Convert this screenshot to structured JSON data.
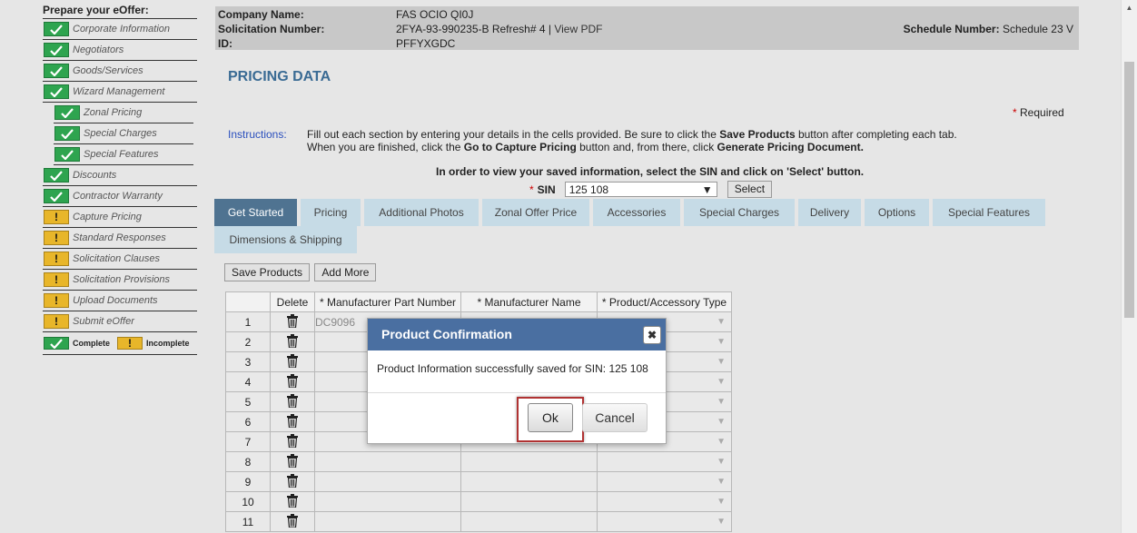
{
  "sidebar": {
    "title": "Prepare your eOffer:",
    "items": [
      {
        "label": "Corporate Information",
        "status": "complete"
      },
      {
        "label": "Negotiators",
        "status": "complete"
      },
      {
        "label": "Goods/Services",
        "status": "complete"
      },
      {
        "label": "Wizard Management",
        "status": "complete"
      },
      {
        "label": "Zonal Pricing",
        "status": "complete",
        "sub": true
      },
      {
        "label": "Special Charges",
        "status": "complete",
        "sub": true
      },
      {
        "label": "Special Features",
        "status": "complete",
        "sub": true
      },
      {
        "label": "Discounts",
        "status": "complete"
      },
      {
        "label": "Contractor Warranty",
        "status": "complete"
      },
      {
        "label": "Capture Pricing",
        "status": "incomplete"
      },
      {
        "label": "Standard Responses",
        "status": "incomplete"
      },
      {
        "label": "Solicitation Clauses",
        "status": "incomplete"
      },
      {
        "label": "Solicitation Provisions",
        "status": "incomplete"
      },
      {
        "label": "Upload Documents",
        "status": "incomplete"
      },
      {
        "label": "Submit eOffer",
        "status": "incomplete"
      }
    ],
    "legend": {
      "complete": "Complete",
      "incomplete": "Incomplete"
    }
  },
  "info": {
    "company_label": "Company Name:",
    "company_value": "FAS OCIO QI0J",
    "solicitation_label": "Solicitation Number:",
    "solicitation_value": "2FYA-93-990235-B Refresh# 4 |",
    "view_pdf": "View PDF",
    "id_label": "ID:",
    "id_value": "PFFYXGDC",
    "schedule_label": "Schedule Number:",
    "schedule_value": "Schedule 23 V"
  },
  "page_title": "PRICING DATA",
  "required": "Required",
  "instructions": {
    "label": "Instructions:",
    "l1a": "Fill out each section by entering your details in the cells provided. Be sure to click the ",
    "l1b": "Save Products",
    "l1c": " button after completing each tab.",
    "l2a": "When you are finished, click the ",
    "l2b": "Go to Capture Pricing",
    "l2c": " button and, from there, click ",
    "l2d": "Generate Pricing Document."
  },
  "sin_note": "In order to view your saved information, select the SIN and click on 'Select' button.",
  "sin": {
    "label": "SIN",
    "value": "125 108",
    "select_button": "Select"
  },
  "tabs": [
    "Get Started",
    "Pricing",
    "Additional Photos",
    "Zonal Offer Price",
    "Accessories",
    "Special Charges",
    "Delivery",
    "Options",
    "Special Features",
    "Dimensions & Shipping"
  ],
  "buttons": {
    "save_products": "Save Products",
    "add_more": "Add More"
  },
  "table": {
    "headers": [
      "",
      "Delete",
      "* Manufacturer Part Number",
      "* Manufacturer Name",
      "* Product/Accessory Type"
    ],
    "rows": [
      "1",
      "2",
      "3",
      "4",
      "5",
      "6",
      "7",
      "8",
      "9",
      "10",
      "11"
    ],
    "first_part": "DC9096"
  },
  "modal": {
    "title": "Product Confirmation",
    "message": "Product Information successfully saved for SIN: 125 108",
    "ok": "Ok",
    "cancel": "Cancel"
  }
}
